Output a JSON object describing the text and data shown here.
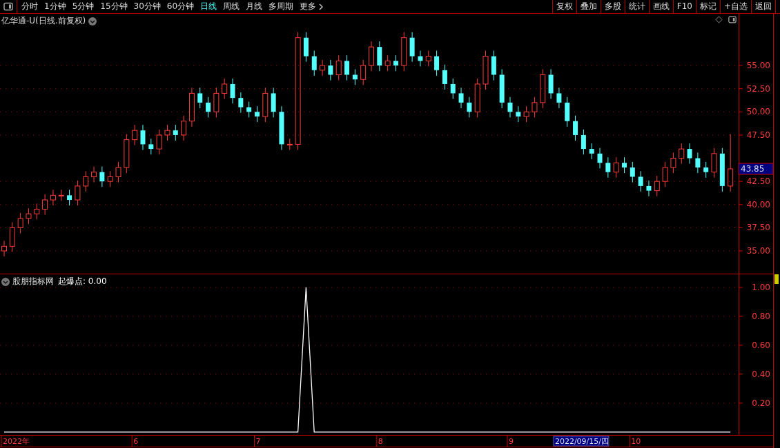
{
  "toolbar": {
    "periods": [
      {
        "label": "分时",
        "selected": false
      },
      {
        "label": "1分钟",
        "selected": false
      },
      {
        "label": "5分钟",
        "selected": false
      },
      {
        "label": "15分钟",
        "selected": false
      },
      {
        "label": "30分钟",
        "selected": false
      },
      {
        "label": "60分钟",
        "selected": false
      },
      {
        "label": "日线",
        "selected": true
      },
      {
        "label": "周线",
        "selected": false
      },
      {
        "label": "月线",
        "selected": false
      },
      {
        "label": "多周期",
        "selected": false
      }
    ],
    "more": "更多",
    "actions": [
      "复权",
      "叠加",
      "多股",
      "统计",
      "画线",
      "F10",
      "标记",
      "+自选",
      "返回"
    ]
  },
  "main_chart": {
    "title": "亿华通-U(日线.前复权)",
    "last_price": "43.85",
    "chart_data": {
      "type": "candlestick",
      "grid": true,
      "ylim": [
        32.55,
        60.58
      ],
      "yticks": [
        {
          "value": 35,
          "label": "35.00"
        },
        {
          "value": 37.5,
          "label": "37.50"
        },
        {
          "value": 40,
          "label": "40.00"
        },
        {
          "value": 42.5,
          "label": "42.50"
        },
        {
          "value": 47.5,
          "label": "47.50"
        },
        {
          "value": 50,
          "label": "50.00"
        },
        {
          "value": 52.5,
          "label": "52.50"
        },
        {
          "value": 55,
          "label": "55.00"
        }
      ],
      "ohlc": [
        [
          35,
          36.1,
          34.4,
          35.5
        ],
        [
          35.5,
          38.1,
          34.9,
          37.5
        ],
        [
          37.5,
          39.1,
          36.9,
          38.5
        ],
        [
          38.5,
          39.6,
          37.9,
          39
        ],
        [
          39,
          40.1,
          38.4,
          39.5
        ],
        [
          39.5,
          41.1,
          38.9,
          40.5
        ],
        [
          40.5,
          41.6,
          39.9,
          41
        ],
        [
          41,
          41.6,
          40.4,
          41
        ],
        [
          41,
          41.6,
          39.9,
          40.5
        ],
        [
          40.5,
          42.6,
          39.9,
          42
        ],
        [
          42,
          43.6,
          41.4,
          43
        ],
        [
          43,
          44.1,
          42.4,
          43.5
        ],
        [
          43.5,
          44.1,
          41.9,
          42.5
        ],
        [
          42.5,
          43.6,
          41.9,
          43
        ],
        [
          43,
          44.6,
          42.4,
          44
        ],
        [
          44,
          47.6,
          43.4,
          47
        ],
        [
          47,
          48.6,
          46.4,
          48
        ],
        [
          48,
          48.6,
          45.9,
          46.5
        ],
        [
          46.5,
          47.1,
          45.4,
          46
        ],
        [
          46,
          48.1,
          45.4,
          47.5
        ],
        [
          47.5,
          48.6,
          46.9,
          48
        ],
        [
          48,
          48.6,
          46.9,
          47.5
        ],
        [
          47.5,
          49.6,
          46.9,
          49
        ],
        [
          49,
          52.6,
          48.4,
          52
        ],
        [
          52,
          52.6,
          50.4,
          51
        ],
        [
          51,
          51.6,
          49.4,
          50
        ],
        [
          50,
          52.6,
          49.4,
          52
        ],
        [
          52,
          53.6,
          51.4,
          53
        ],
        [
          53,
          53.6,
          50.9,
          51.5
        ],
        [
          51.5,
          52.1,
          49.9,
          50.5
        ],
        [
          50.5,
          51.1,
          49.4,
          50
        ],
        [
          50,
          50.6,
          48.9,
          49.5
        ],
        [
          49.5,
          52.6,
          48.9,
          52
        ],
        [
          52,
          52.6,
          49.4,
          50
        ],
        [
          50,
          50.6,
          45.9,
          46.5
        ],
        [
          46.5,
          47.1,
          45.9,
          46.5
        ],
        [
          46.5,
          58.6,
          45.9,
          58
        ],
        [
          58,
          58.6,
          55.4,
          56
        ],
        [
          56,
          56.6,
          53.9,
          54.5
        ],
        [
          54.5,
          55.6,
          53.9,
          55
        ],
        [
          55,
          55.6,
          53.4,
          54
        ],
        [
          54,
          56.1,
          53.4,
          55.5
        ],
        [
          55.5,
          56.1,
          53.4,
          54
        ],
        [
          54,
          54.6,
          52.9,
          53.5
        ],
        [
          53.5,
          55.6,
          52.9,
          55
        ],
        [
          55,
          57.6,
          54.4,
          57
        ],
        [
          57,
          57.6,
          54.4,
          55
        ],
        [
          55,
          56.1,
          54.4,
          55.5
        ],
        [
          55.5,
          56.1,
          54.4,
          55
        ],
        [
          55,
          58.6,
          54.4,
          58
        ],
        [
          58,
          58.6,
          55.4,
          56
        ],
        [
          56,
          56.6,
          54.9,
          55.5
        ],
        [
          55.5,
          56.6,
          54.9,
          56
        ],
        [
          56,
          56.6,
          53.9,
          54.5
        ],
        [
          54.5,
          55.1,
          52.4,
          53
        ],
        [
          53,
          53.6,
          51.4,
          52
        ],
        [
          52,
          52.6,
          50.4,
          51
        ],
        [
          51,
          51.6,
          49.4,
          50
        ],
        [
          50,
          53.6,
          49.4,
          53
        ],
        [
          53,
          56.6,
          52.4,
          56
        ],
        [
          56,
          56.6,
          53.4,
          54
        ],
        [
          54,
          54.6,
          50.4,
          51
        ],
        [
          51,
          51.6,
          49.4,
          50
        ],
        [
          50,
          50.6,
          48.9,
          49.5
        ],
        [
          49.5,
          50.6,
          48.9,
          50
        ],
        [
          50,
          51.6,
          49.4,
          51
        ],
        [
          51,
          54.6,
          50.4,
          54
        ],
        [
          54,
          54.6,
          51.4,
          52
        ],
        [
          52,
          52.6,
          50.4,
          51
        ],
        [
          51,
          51.6,
          48.4,
          49
        ],
        [
          49,
          49.6,
          46.9,
          47.5
        ],
        [
          47.5,
          48.1,
          45.4,
          46
        ],
        [
          46,
          46.6,
          44.9,
          45.5
        ],
        [
          45.5,
          46.1,
          43.9,
          44.5
        ],
        [
          44.5,
          45.1,
          42.9,
          43.5
        ],
        [
          43.5,
          45.1,
          42.9,
          44.5
        ],
        [
          44.5,
          45.1,
          43.4,
          44
        ],
        [
          44,
          44.6,
          42.4,
          43
        ],
        [
          43,
          43.6,
          41.4,
          42
        ],
        [
          42,
          42.6,
          40.9,
          41.5
        ],
        [
          41.5,
          43.1,
          40.9,
          42.5
        ],
        [
          42.5,
          44.6,
          41.9,
          44
        ],
        [
          44,
          45.6,
          43.4,
          45
        ],
        [
          45,
          46.6,
          44.4,
          46
        ],
        [
          46,
          46.6,
          44.4,
          45
        ],
        [
          45,
          45.6,
          43.4,
          44
        ],
        [
          44,
          44.6,
          42.9,
          43.5
        ],
        [
          43.5,
          46.1,
          42.9,
          45.5
        ],
        [
          45.5,
          46.1,
          41.4,
          42
        ],
        [
          42,
          47.6,
          41.4,
          43.85
        ]
      ]
    }
  },
  "indicator": {
    "name": "股朋指标网",
    "label": "起爆点: 0.00",
    "chart_data": {
      "type": "line",
      "grid": true,
      "ylim": [
        -0.02,
        1.09
      ],
      "yticks": [
        {
          "value": 0.2,
          "label": "0.20"
        },
        {
          "value": 0.4,
          "label": "0.40"
        },
        {
          "value": 0.6,
          "label": "0.60"
        },
        {
          "value": 0.8,
          "label": "0.80"
        },
        {
          "value": 1,
          "label": "1.00"
        }
      ],
      "series": [
        {
          "values": [
            0,
            0,
            0,
            0,
            0,
            0,
            0,
            0,
            0,
            0,
            0,
            0,
            0,
            0,
            0,
            0,
            0,
            0,
            0,
            0,
            0,
            0,
            0,
            0,
            0,
            0,
            0,
            0,
            0,
            0,
            0,
            0,
            0,
            0,
            0,
            0,
            0,
            1,
            0,
            0,
            0,
            0,
            0,
            0,
            0,
            0,
            0,
            0,
            0,
            0,
            0,
            0,
            0,
            0,
            0,
            0,
            0,
            0,
            0,
            0,
            0,
            0,
            0,
            0,
            0,
            0,
            0,
            0,
            0,
            0,
            0,
            0,
            0,
            0,
            0,
            0,
            0,
            0,
            0,
            0,
            0,
            0,
            0,
            0,
            0,
            0,
            0,
            0,
            0,
            0
          ]
        }
      ]
    }
  },
  "time_axis": {
    "labels": [
      "2022年",
      "6",
      "7",
      "8",
      "9",
      "10"
    ],
    "cursor_date": "2022/09/15/四"
  }
}
